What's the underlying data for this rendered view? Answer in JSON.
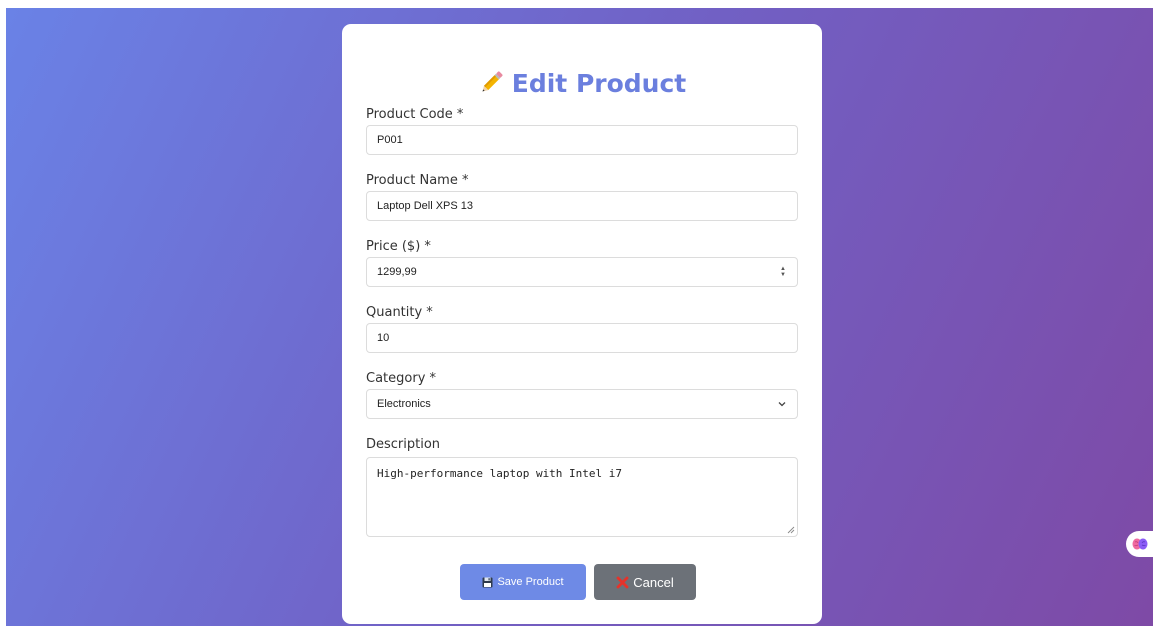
{
  "form": {
    "title": "Edit Product",
    "fields": {
      "code": {
        "label": "Product Code *",
        "value": "P001"
      },
      "name": {
        "label": "Product Name *",
        "value": "Laptop Dell XPS 13"
      },
      "price": {
        "label": "Price ($) *",
        "value": "1299,99"
      },
      "quantity": {
        "label": "Quantity *",
        "value": "10"
      },
      "category": {
        "label": "Category *",
        "value": "Electronics"
      },
      "description": {
        "label": "Description",
        "value": "High-performance laptop with Intel i7"
      }
    },
    "buttons": {
      "save": "Save Product",
      "cancel": "Cancel"
    }
  },
  "icons": {
    "title_icon": "pencil-icon",
    "save_icon": "floppy-disk-icon",
    "cancel_icon": "cross-mark-icon",
    "floating_icon": "brain-icon"
  },
  "colors": {
    "accent": "#6b7fde",
    "save_button": "#6e8ae6",
    "cancel_button": "#6c7178",
    "cancel_x": "#e5332a",
    "background_start": "#6a82e6",
    "background_end": "#7e4aa6"
  }
}
